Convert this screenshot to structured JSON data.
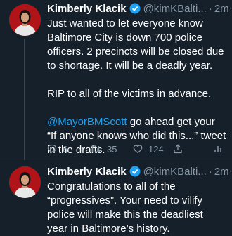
{
  "tweets": [
    {
      "name": "Kimberly Klacik",
      "handle": "@kimKBalti...",
      "separator": "·",
      "time": "2m",
      "more": "···",
      "paragraphs": [
        "Just wanted to let everyone know Baltimore City is down 700 police officers. 2 precincts will be closed due to shortage. It will be a deadly year.",
        "RIP to all of the victims in advance."
      ],
      "mention": "@MayorBMScott",
      "mention_rest": " go ahead get your “If anyone knows who did this...” tweet in the drafts.",
      "actions": {
        "replies": "6",
        "retweets": "35",
        "likes": "124"
      }
    },
    {
      "name": "Kimberly Klacik",
      "handle": "@kimKBalti...",
      "separator": "·",
      "time": "2m",
      "more": "···",
      "text": "Congratulations to all of the “progressives”. Your need to vilify police will make this the deadliest year in Baltimore’s history."
    }
  ],
  "colors": {
    "background": "#15202b",
    "text": "#ffffff",
    "secondary": "#8899a6",
    "link": "#1da1f2",
    "verified": "#1da1f2",
    "avatar_bg": "#b01418"
  },
  "icons": [
    "verified-badge-icon",
    "reply-icon",
    "retweet-icon",
    "like-icon",
    "share-icon",
    "analytics-icon",
    "more-icon"
  ]
}
